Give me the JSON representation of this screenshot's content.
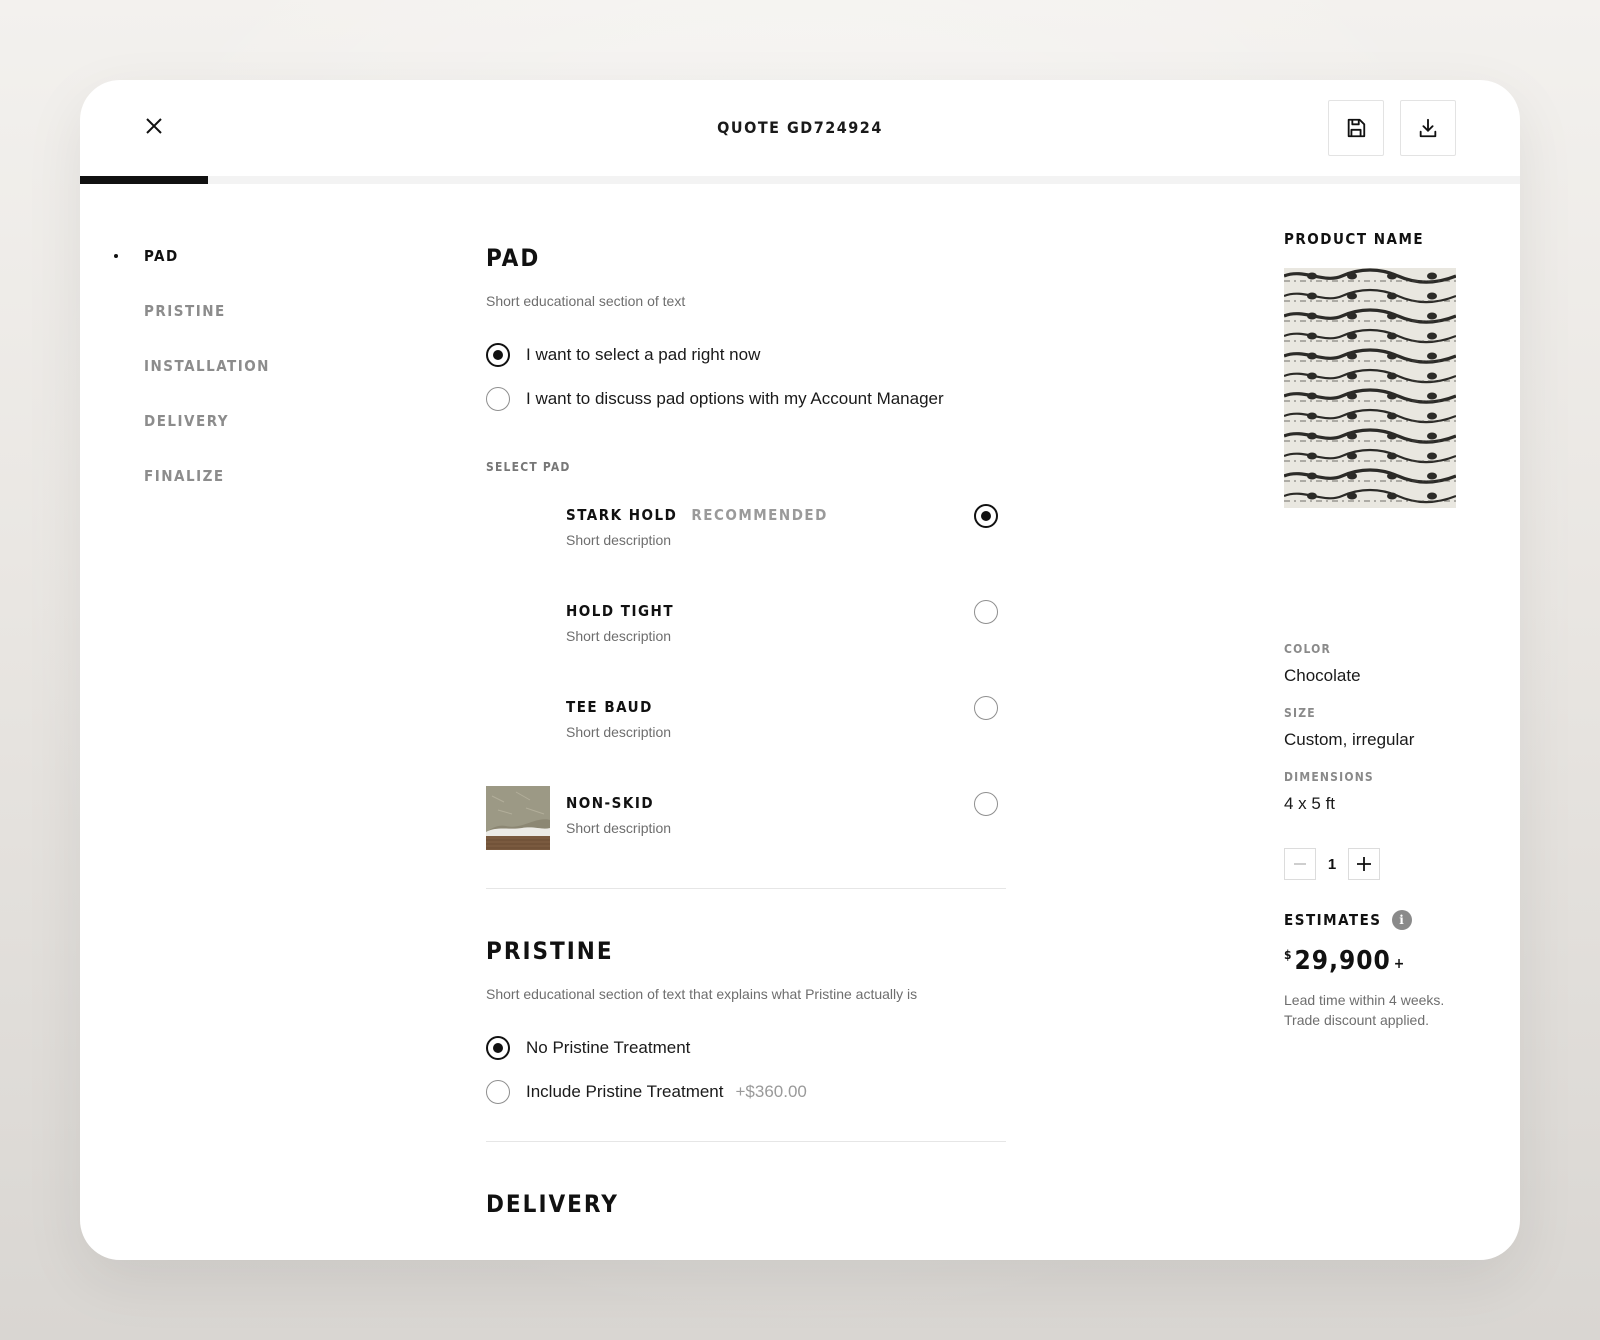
{
  "header": {
    "title": "QUOTE GD724924",
    "progress_fraction": 0.089
  },
  "nav": {
    "items": [
      {
        "label": "PAD"
      },
      {
        "label": "PRISTINE"
      },
      {
        "label": "INSTALLATION"
      },
      {
        "label": "DELIVERY"
      },
      {
        "label": "FINALIZE"
      }
    ]
  },
  "pad_section": {
    "title": "PAD",
    "description": "Short educational section of text",
    "options": [
      {
        "label": "I want to select a pad right now",
        "selected": true
      },
      {
        "label": "I want to discuss pad options with my Account Manager",
        "selected": false
      }
    ],
    "select_label": "SELECT PAD",
    "pads": [
      {
        "name": "STARK HOLD",
        "badge": "RECOMMENDED",
        "description": "Short description",
        "selected": true
      },
      {
        "name": "HOLD TIGHT",
        "description": "Short description",
        "selected": false
      },
      {
        "name": "TEE BAUD",
        "description": "Short description",
        "selected": false
      },
      {
        "name": "NON-SKID",
        "description": "Short description",
        "selected": false
      }
    ]
  },
  "pristine_section": {
    "title": "PRISTINE",
    "description": "Short educational section of text that explains what Pristine actually is",
    "options": [
      {
        "label": "No Pristine Treatment",
        "selected": true
      },
      {
        "label": "Include Pristine Treatment",
        "price": "+$360.00",
        "selected": false
      }
    ]
  },
  "delivery_section": {
    "title": "DELIVERY"
  },
  "product": {
    "name": "PRODUCT NAME",
    "color_label": "COLOR",
    "color_value": "Chocolate",
    "size_label": "SIZE",
    "size_value": "Custom, irregular",
    "dimensions_label": "DIMENSIONS",
    "dimensions_value": "4 x 5 ft",
    "quantity": "1",
    "estimates_label": "ESTIMATES",
    "currency": "$",
    "price": "29,900",
    "price_suffix": "+",
    "note_line1": "Lead time within 4 weeks.",
    "note_line2": "Trade discount applied."
  },
  "colors": {
    "accent": "#111111",
    "muted": "#8c8c8c"
  }
}
